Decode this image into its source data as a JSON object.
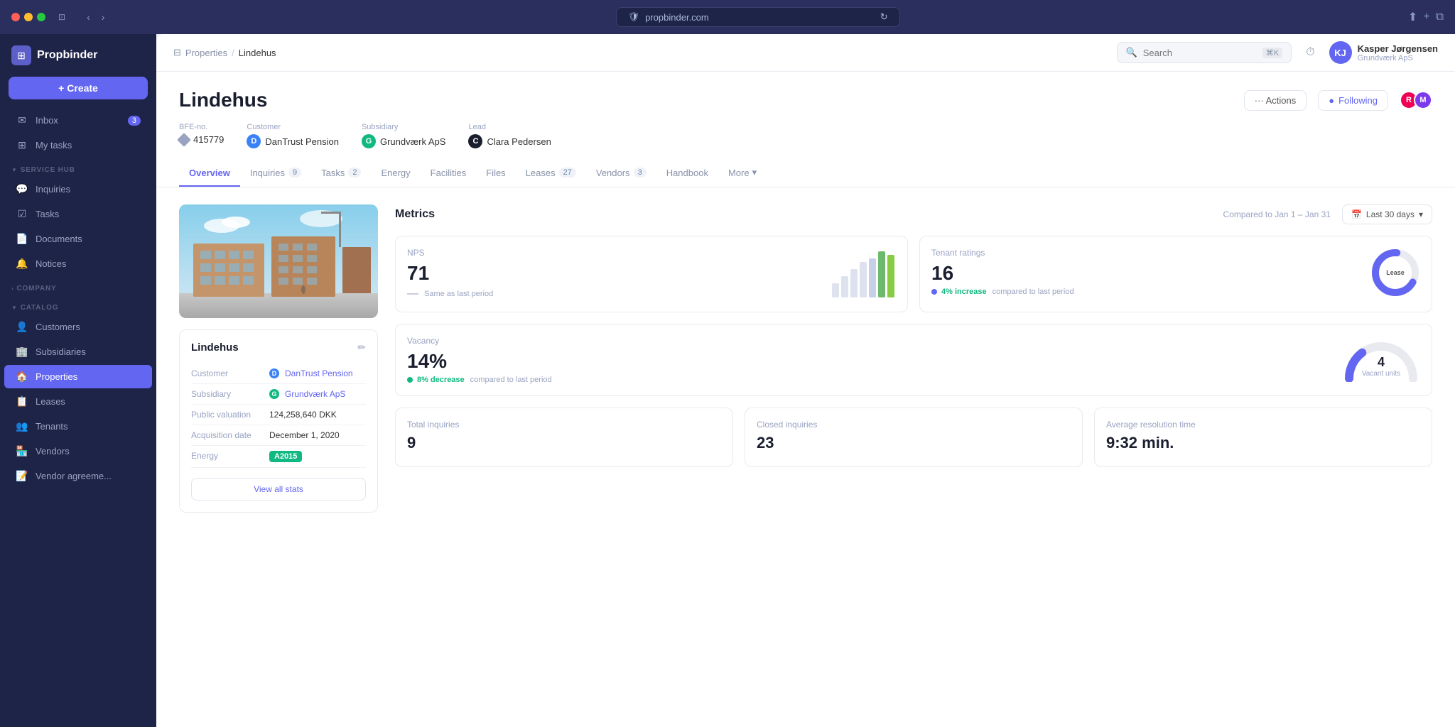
{
  "browser": {
    "url": "propbinder.com",
    "shield": "🛡",
    "refresh": "↻"
  },
  "sidebar": {
    "logo_text": "Propbinder",
    "create_label": "+ Create",
    "nav_items": [
      {
        "id": "inbox",
        "label": "Inbox",
        "icon": "✉",
        "badge": "3"
      },
      {
        "id": "my-tasks",
        "label": "My tasks",
        "icon": "⊞",
        "badge": ""
      }
    ],
    "service_hub_label": "SERVICE HUB",
    "service_items": [
      {
        "id": "inquiries",
        "label": "Inquiries",
        "icon": "💬",
        "badge": ""
      },
      {
        "id": "tasks",
        "label": "Tasks",
        "icon": "☑",
        "badge": ""
      },
      {
        "id": "documents",
        "label": "Documents",
        "icon": "📄",
        "badge": ""
      },
      {
        "id": "notices",
        "label": "Notices",
        "icon": "🔔",
        "badge": ""
      }
    ],
    "company_label": "COMPANY",
    "catalog_label": "CATALOG",
    "catalog_items": [
      {
        "id": "customers",
        "label": "Customers",
        "icon": "👤",
        "badge": ""
      },
      {
        "id": "subsidiaries",
        "label": "Subsidiaries",
        "icon": "🏢",
        "badge": ""
      },
      {
        "id": "properties",
        "label": "Properties",
        "icon": "🏠",
        "badge": "",
        "active": true
      },
      {
        "id": "leases",
        "label": "Leases",
        "icon": "📋",
        "badge": ""
      },
      {
        "id": "tenants",
        "label": "Tenants",
        "icon": "👥",
        "badge": ""
      },
      {
        "id": "vendors",
        "label": "Vendors",
        "icon": "🏪",
        "badge": ""
      },
      {
        "id": "vendor-agreements",
        "label": "Vendor agreeme...",
        "icon": "📝",
        "badge": ""
      }
    ]
  },
  "topbar": {
    "breadcrumb_parent": "Properties",
    "breadcrumb_current": "Lindehus",
    "search_placeholder": "Search",
    "shortcut": "⌘K",
    "user": {
      "name": "Kasper Jørgensen",
      "company": "Grundværk ApS",
      "initials": "KJ"
    }
  },
  "property": {
    "title": "Lindehus",
    "actions_label": "··· Actions",
    "following_label": "Following",
    "meta": {
      "bfe_label": "BFE-no.",
      "bfe_value": "415779",
      "customer_label": "Customer",
      "customer_value": "DanTrust Pension",
      "customer_initial": "D",
      "subsidiary_label": "Subsidiary",
      "subsidiary_value": "Grundværk ApS",
      "subsidiary_initial": "G",
      "lead_label": "Lead",
      "lead_value": "Clara Pedersen",
      "lead_initial": "C"
    },
    "tabs": [
      {
        "id": "overview",
        "label": "Overview",
        "badge": "",
        "active": true
      },
      {
        "id": "inquiries",
        "label": "Inquiries",
        "badge": "9"
      },
      {
        "id": "tasks",
        "label": "Tasks",
        "badge": "2"
      },
      {
        "id": "energy",
        "label": "Energy",
        "badge": ""
      },
      {
        "id": "facilities",
        "label": "Facilities",
        "badge": ""
      },
      {
        "id": "files",
        "label": "Files",
        "badge": ""
      },
      {
        "id": "leases",
        "label": "Leases",
        "badge": "27"
      },
      {
        "id": "vendors",
        "label": "Vendors",
        "badge": "3"
      },
      {
        "id": "handbook",
        "label": "Handbook",
        "badge": ""
      },
      {
        "id": "more",
        "label": "More",
        "badge": ""
      }
    ],
    "card": {
      "name": "Lindehus",
      "customer_label": "Customer",
      "customer_value": "DanTrust Pension",
      "subsidiary_label": "Subsidiary",
      "subsidiary_value": "Grundværk ApS",
      "public_val_label": "Public valuation",
      "public_val_value": "124,258,640 DKK",
      "acquisition_label": "Acquisition date",
      "acquisition_value": "December 1, 2020",
      "energy_label": "Energy",
      "energy_value": "A2015",
      "view_all_label": "View all stats"
    },
    "metrics": {
      "title": "Metrics",
      "period_compare": "Compared to Jan 1 – Jan 31",
      "date_range": "Last 30 days",
      "nps": {
        "label": "NPS",
        "value": "71",
        "sub": "Same as last period"
      },
      "tenant_ratings": {
        "label": "Tenant ratings",
        "value": "16",
        "sub_prefix": "4% increase",
        "sub_suffix": "compared to last period",
        "donut_label": "Lease"
      },
      "vacancy": {
        "label": "Vacancy",
        "value": "14%",
        "sub_prefix": "8% decrease",
        "sub_suffix": "compared to last period",
        "vacant_units": "4",
        "vacant_label": "Vacant units"
      },
      "total_inquiries": {
        "label": "Total inquiries",
        "value": "9"
      },
      "closed_inquiries": {
        "label": "Closed inquiries",
        "value": "23"
      },
      "avg_resolution": {
        "label": "Average resolution time",
        "value": "9:32 min."
      }
    }
  }
}
